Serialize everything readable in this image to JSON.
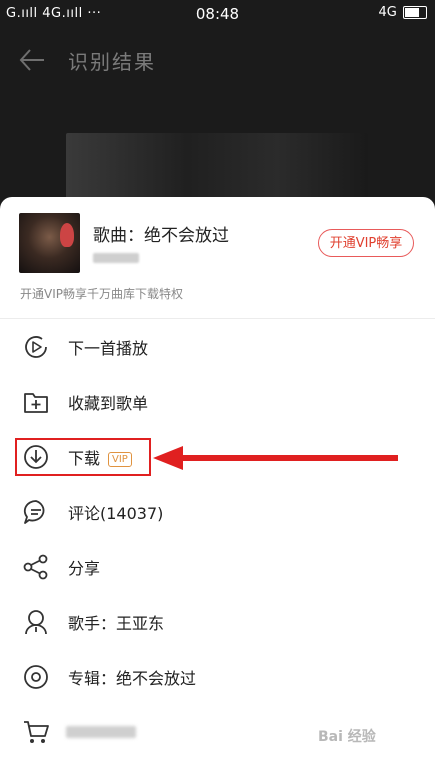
{
  "status_bar": {
    "left": "G.ııll 4G.ııll ···",
    "time": "08:48",
    "right": "4G"
  },
  "header": {
    "title": "识别结果"
  },
  "song": {
    "title": "歌曲：绝不会放过",
    "vip_button": "开通VIP畅享",
    "vip_note": "开通VIP畅享千万曲库下载特权"
  },
  "menu": [
    {
      "label": "下一首播放",
      "icon": "play-next-icon"
    },
    {
      "label": "收藏到歌单",
      "icon": "add-to-playlist-icon"
    },
    {
      "label": "下载",
      "icon": "download-icon",
      "badge": "VIP"
    },
    {
      "label": "评论(14037)",
      "icon": "comment-icon"
    },
    {
      "label": "分享",
      "icon": "share-icon"
    },
    {
      "label": "歌手：王亚东",
      "icon": "singer-icon"
    },
    {
      "label": "专辑：绝不会放过",
      "icon": "album-icon"
    },
    {
      "label": "",
      "icon": "cart-icon"
    }
  ],
  "watermark": "Bai 经验"
}
